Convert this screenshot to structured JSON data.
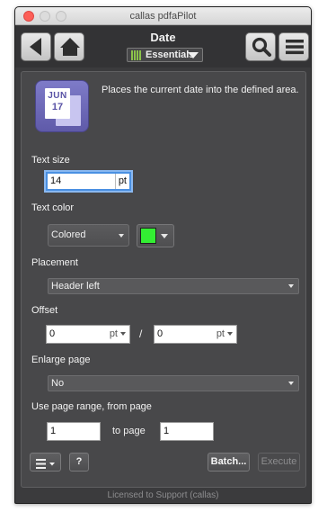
{
  "window": {
    "title": "callas pdfaPilot"
  },
  "toolbar": {
    "title": "Date",
    "profile_selector": "Essentials",
    "back_icon": "back-arrow-icon",
    "home_icon": "home-icon",
    "search_icon": "magnifier-icon",
    "menu_icon": "hamburger-menu-icon"
  },
  "header": {
    "icon_month": "JUN",
    "icon_day": "17",
    "description": "Places the current date into the defined area."
  },
  "form": {
    "text_size": {
      "label": "Text size",
      "value": "14",
      "unit": "pt"
    },
    "text_color": {
      "label": "Text color",
      "mode": "Colored",
      "swatch": "#33ee33"
    },
    "placement": {
      "label": "Placement",
      "value": "Header left"
    },
    "offset": {
      "label": "Offset",
      "x": "0",
      "x_unit": "pt",
      "separator": "/",
      "y": "0",
      "y_unit": "pt"
    },
    "enlarge_page": {
      "label": "Enlarge page",
      "value": "No"
    },
    "page_range": {
      "label": "Use page range, from page",
      "from": "1",
      "to_label": "to page",
      "to": "1"
    }
  },
  "bottom": {
    "list_menu_icon": "list-icon",
    "help_label": "?",
    "batch_label": "Batch...",
    "execute_label": "Execute"
  },
  "footer": {
    "license": "Licensed to Support (callas)"
  },
  "colors": {
    "accent": "#4a90e2",
    "text_color_swatch": "#33ee33",
    "essentials_bars": "#8bc34a"
  }
}
